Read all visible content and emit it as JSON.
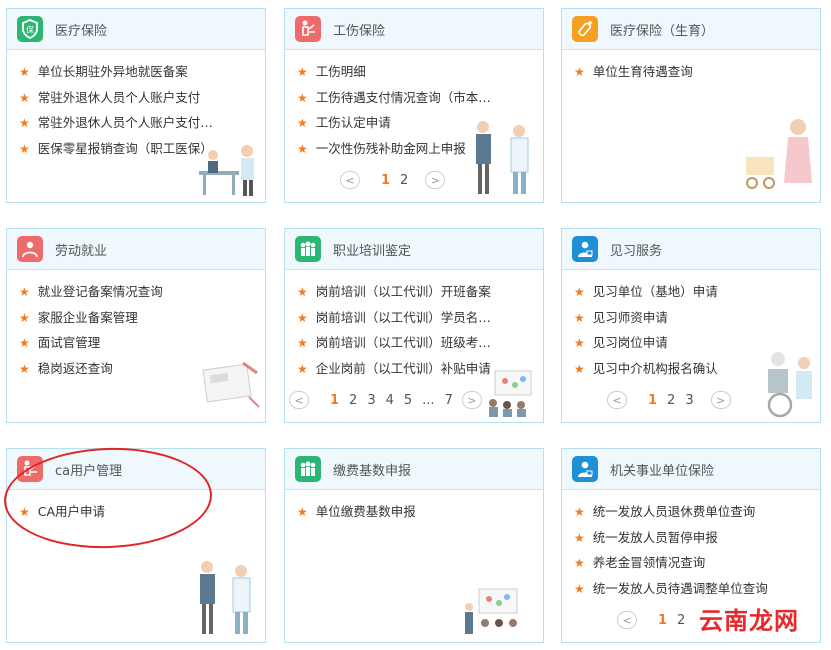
{
  "colors": {
    "accent": "#f37b1d",
    "border": "#b8dff1",
    "header_bg": "#eef8fd",
    "icon_green": "#2bb673",
    "icon_pink": "#ee6b6b",
    "icon_orange": "#f4a020",
    "icon_blue": "#1f8fd6",
    "annotation_red": "#e42222"
  },
  "cards": [
    {
      "title": "医疗保险",
      "icon": "shield-icon",
      "items": [
        "单位长期驻外异地就医备案",
        "常驻外退休人员个人账户支付",
        "常驻外退休人员个人账户支付…",
        "医保零星报销查询（职工医保）"
      ]
    },
    {
      "title": "工伤保险",
      "icon": "injured-person-icon",
      "items": [
        "工伤明细",
        "工伤待遇支付情况查询（市本…",
        "工伤认定申请",
        "一次性伤残补助金网上申报"
      ],
      "pager": [
        "1",
        "2"
      ],
      "current_page": "1"
    },
    {
      "title": "医疗保险（生育）",
      "icon": "baby-bottle-icon",
      "items": [
        "单位生育待遇查询"
      ]
    },
    {
      "title": "劳动就业",
      "icon": "worker-icon",
      "items": [
        "就业登记备案情况查询",
        "家服企业备案管理",
        "面试官管理",
        "稳岗返还查询"
      ]
    },
    {
      "title": "职业培训鉴定",
      "icon": "group-icon",
      "items": [
        "岗前培训（以工代训）开班备案",
        "岗前培训（以工代训）学员名…",
        "岗前培训（以工代训）班级考…",
        "企业岗前（以工代训）补贴申请"
      ],
      "pager": [
        "1",
        "2",
        "3",
        "4",
        "5",
        "...",
        "7"
      ],
      "current_page": "1"
    },
    {
      "title": "见习服务",
      "icon": "trainee-icon",
      "items": [
        "见习单位（基地）申请",
        "见习师资申请",
        "见习岗位申请",
        "见习中介机构报名确认"
      ],
      "pager": [
        "1",
        "2",
        "3"
      ],
      "current_page": "1"
    },
    {
      "title": "ca用户管理",
      "icon": "ca-user-icon",
      "items": [
        "CA用户申请"
      ]
    },
    {
      "title": "缴费基数申报",
      "icon": "group-icon",
      "items": [
        "单位缴费基数申报"
      ]
    },
    {
      "title": "机关事业单位保险",
      "icon": "trainee-icon",
      "items": [
        "统一发放人员退休费单位查询",
        "统一发放人员暂停申报",
        "养老金冒领情况查询",
        "统一发放人员待遇调整单位查询"
      ],
      "pager": [
        "1",
        "2"
      ],
      "current_page": "1"
    }
  ],
  "watermark": "云南龙网"
}
